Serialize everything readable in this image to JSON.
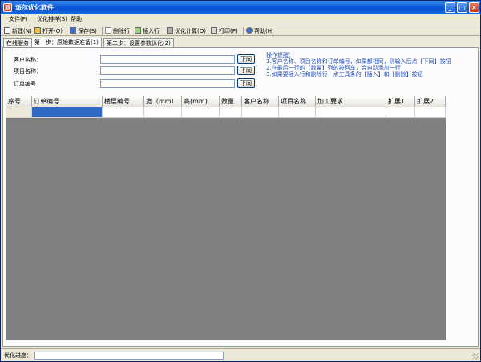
{
  "window": {
    "title": "派尔优化软件",
    "app_icon": "派"
  },
  "menu": {
    "file": "文件(F)",
    "sort": "优化排样(S)",
    "help": "帮助"
  },
  "toolbar": {
    "new": "新建(N)",
    "open": "打开(O)",
    "save": "保存(S)",
    "delete_row": "删除行",
    "insert_row": "插入行",
    "optimize": "优化计算(O)",
    "print": "打印(P)",
    "help": "帮助(H)"
  },
  "tabs": [
    {
      "label": "在线服务",
      "active": false
    },
    {
      "label": "第一步：原始数据准备(1)",
      "active": true
    },
    {
      "label": "第二步：设置参数优化(2)",
      "active": false
    }
  ],
  "form": {
    "customer_label": "客户名称：",
    "project_label": "项目名称：",
    "order_label": "订单编号",
    "customer_value": "",
    "project_value": "",
    "order_value": "",
    "same_button": "下同"
  },
  "tips": {
    "title": "操作提醒：",
    "lines": [
      "1.客户名称、项目名称和订单编号，如果都相同，则输入后点【下同】按钮",
      "2.在最后一行的【数量】列的按回车，会自动添加一行",
      "3.如果要插入行和删除行，点工具条的【插入】和【删除】按钮"
    ]
  },
  "grid": {
    "columns": [
      "序号",
      "订单编号",
      "楼层编号",
      "宽（mm）",
      "高(mm)",
      "数量",
      "客户名称",
      "项目名称",
      "加工要求",
      "扩展1",
      "扩展2"
    ],
    "rows": [
      [
        "",
        "",
        "",
        "",
        "",
        "",
        "",
        "",
        "",
        "",
        ""
      ]
    ]
  },
  "status": {
    "label": "优化进度：",
    "progress": 0
  },
  "colors": {
    "title_bar": "#0b5ddc",
    "selection": "#316ac5",
    "tips_text": "#2550b8",
    "grid_empty": "#808080"
  },
  "icons": [
    "new-icon",
    "open-icon",
    "save-icon",
    "delete-row-icon",
    "insert-row-icon",
    "optimize-icon",
    "print-icon",
    "help-icon"
  ]
}
